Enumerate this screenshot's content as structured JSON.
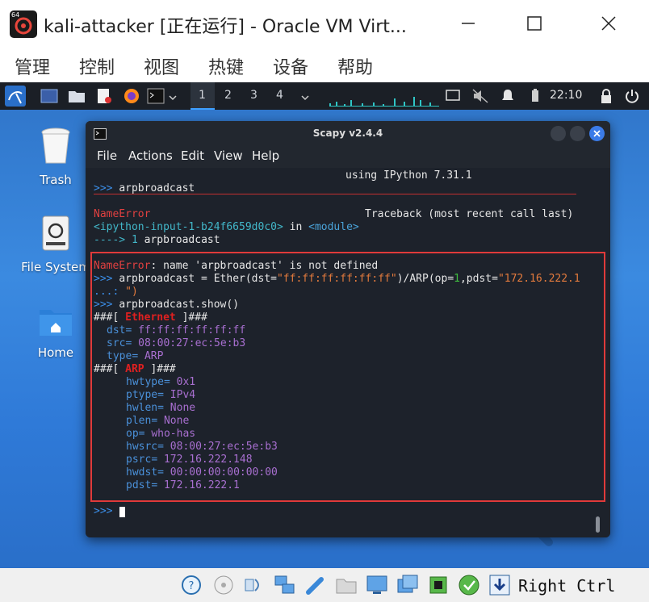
{
  "window": {
    "title": "kali-attacker [正在运行] - Oracle VM Virt...",
    "app_icon_tag": "64"
  },
  "vbox_menu": [
    "管理",
    "控制",
    "视图",
    "热键",
    "设备",
    "帮助"
  ],
  "kali_panel": {
    "workspaces": [
      "1",
      "2",
      "3",
      "4"
    ],
    "active_workspace": "1",
    "clock": "22:10"
  },
  "desktop_icons": [
    {
      "label": "Trash",
      "icon": "trash-icon"
    },
    {
      "label": "File System",
      "icon": "drive-icon"
    },
    {
      "label": "Home",
      "icon": "home-folder-icon"
    }
  ],
  "terminal": {
    "title": "Scapy v2.4.4",
    "menu": [
      "File",
      "Actions",
      "Edit",
      "View",
      "Help"
    ],
    "lines": {
      "l0": "using IPython 7.31.1",
      "p1": ">>> ",
      "c1": "arpbroadcast",
      "e1a": "NameError",
      "e1b": "Traceback (most recent call last)",
      "e2a": "<ipython-input-1-b24f6659d0c0>",
      "e2b": " in ",
      "e2c": "<module>",
      "e3a": "----> 1 ",
      "e3b": "arpbroadcast",
      "h1a": "NameError",
      "h1b": ": name 'arpbroadcast' is not defined",
      "h2p": ">>> ",
      "h2a": "arpbroadcast = Ether(dst=",
      "h2b": "\"ff:ff:ff:ff:ff:ff\"",
      "h2c": ")/ARP(op=",
      "h2d": "1",
      "h2e": ",pdst=",
      "h2f": "\"172.16.222.1",
      "h3p": "...: ",
      "h3a": "\")",
      "h4p": ">>> ",
      "h4a": "arpbroadcast.show()",
      "eth_open": "###[ ",
      "eth_name": "Ethernet",
      "eth_close": " ]###",
      "arp_open": "###[ ",
      "arp_name": "ARP",
      "arp_close": " ]###",
      "last_prompt": ">>> "
    },
    "ethernet_fields": [
      {
        "k": "dst",
        "v": "ff:ff:ff:ff:ff:ff"
      },
      {
        "k": "src",
        "v": "08:00:27:ec:5e:b3"
      },
      {
        "k": "type",
        "v": "ARP"
      }
    ],
    "arp_fields": [
      {
        "k": "hwtype",
        "v": "0x1"
      },
      {
        "k": "ptype",
        "v": "IPv4"
      },
      {
        "k": "hwlen",
        "v": "None"
      },
      {
        "k": "plen",
        "v": "None"
      },
      {
        "k": "op",
        "v": "who-has"
      },
      {
        "k": "hwsrc",
        "v": "08:00:27:ec:5e:b3"
      },
      {
        "k": "psrc",
        "v": "172.16.222.148"
      },
      {
        "k": "hwdst",
        "v": "00:00:00:00:00:00"
      },
      {
        "k": "pdst",
        "v": "172.16.222.1"
      }
    ]
  },
  "status_bar": {
    "host_key": "Right Ctrl",
    "icons": [
      "hard-disk-icon",
      "optical-drive-icon",
      "audio-icon",
      "network-icon",
      "usb-icon",
      "shared-folder-icon",
      "display-icon",
      "recording-icon",
      "cpu-icon",
      "mouse-integration-icon",
      "host-key-arrow-icon"
    ]
  },
  "colors": {
    "terminal_bg": "#1d222b",
    "highlight_border": "#e03a3a",
    "desktop_blue": "#3b8ae0"
  }
}
